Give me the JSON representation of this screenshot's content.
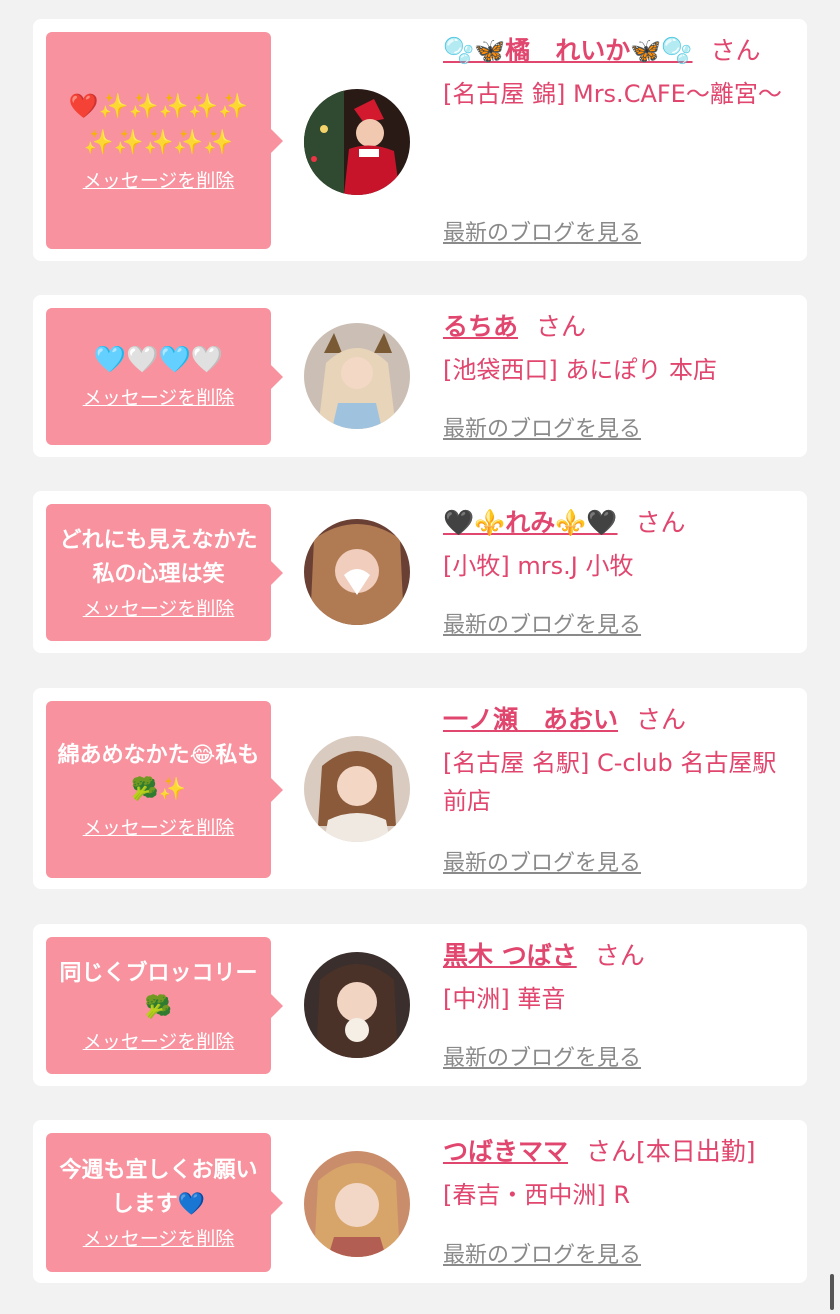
{
  "delete_label": "メッセージを削除",
  "blog_label": "最新のブログを見る",
  "suffix_san": "さん",
  "accent_color": "#e0466e",
  "bubble_color": "#f8929e",
  "cards": [
    {
      "message": "❤️✨✨✨✨✨✨✨✨✨✨",
      "name": "🫧🦋橘　れいか🦋🫧",
      "status": "",
      "shop": "[名古屋 錦] Mrs.CAFE〜離宮〜"
    },
    {
      "message": "🩵🤍🩵🤍",
      "name": "るちあ",
      "status": "",
      "shop": "[池袋西口] あにぽり 本店"
    },
    {
      "message": "どれにも見えなかた私の心理は笑",
      "name": "🖤⚜️れみ⚜️🖤",
      "status": "",
      "shop": "[小牧] mrs.J 小牧"
    },
    {
      "message": "綿あめなかた😂私も🥦✨",
      "name": "一ノ瀬　あおい",
      "status": "",
      "shop": "[名古屋 名駅] C-club 名古屋駅前店"
    },
    {
      "message": "同じくブロッコリー🥦",
      "name": "黒木 つばさ",
      "status": "",
      "shop": "[中洲] 華音"
    },
    {
      "message": "今週も宜しくお願いします💙",
      "name": "つばきママ",
      "status": "[本日出勤]",
      "shop": "[春吉・西中洲] R"
    }
  ]
}
